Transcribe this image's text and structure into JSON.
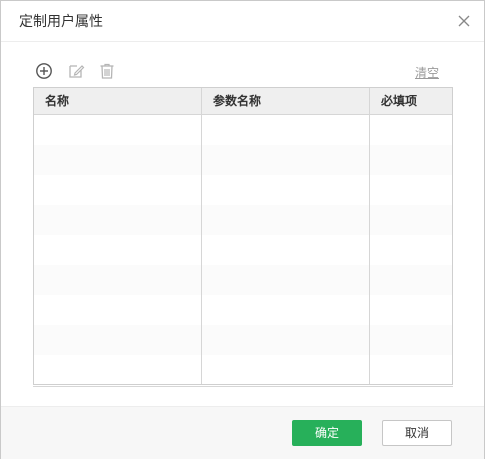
{
  "dialog": {
    "title": "定制用户属性"
  },
  "toolbar": {
    "add_icon": "plus-circle-icon",
    "edit_icon": "edit-icon",
    "delete_icon": "trash-icon",
    "clear_label": "清空"
  },
  "table": {
    "columns": [
      "名称",
      "参数名称",
      "必填项"
    ],
    "rows": []
  },
  "footer": {
    "ok_label": "确定",
    "cancel_label": "取消"
  },
  "colors": {
    "primary": "#27b05a",
    "header_bg": "#efefef",
    "border": "#cfcfcf"
  }
}
